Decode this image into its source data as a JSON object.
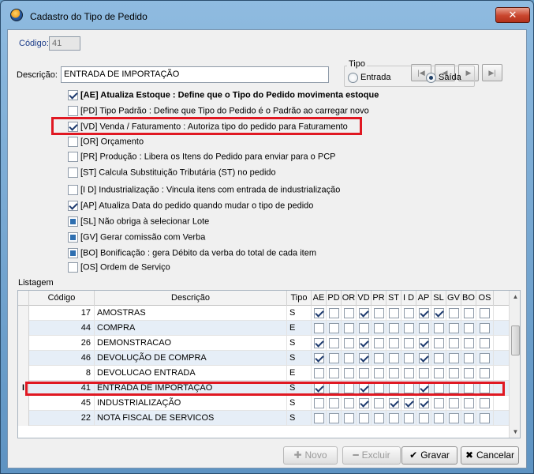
{
  "window": {
    "title": "Cadastro do Tipo de Pedido",
    "close_glyph": "✕"
  },
  "header": {
    "codigo_label": "Código:",
    "codigo_value": "41",
    "descricao_label": "Descrição:",
    "descricao_value": "ENTRADA DE IMPORTAÇÃO"
  },
  "nav_buttons": [
    {
      "name": "first-record-icon",
      "glyph": "|◀"
    },
    {
      "name": "prev-record-icon",
      "glyph": "◀"
    },
    {
      "name": "next-record-icon",
      "glyph": "▶"
    },
    {
      "name": "last-record-icon",
      "glyph": "▶|"
    }
  ],
  "tipo": {
    "label": "Tipo",
    "options": [
      {
        "label": "Entrada",
        "selected": false
      },
      {
        "label": "Saída",
        "selected": true
      }
    ]
  },
  "flags": [
    {
      "text": "[AE] Atualiza Estoque :  Define que o Tipo do Pedido movimenta estoque",
      "state": "checked",
      "bold": true
    },
    {
      "text": "[PD] Tipo Padrão :  Define que Tipo do Pedido é o Padrão ao carregar novo",
      "state": "unchecked",
      "bold": false
    },
    {
      "text": "[VD] Venda / Faturamento :  Autoriza tipo do pedido para Faturamento",
      "state": "checked",
      "bold": false
    },
    {
      "text": "[OR] Orçamento",
      "state": "unchecked",
      "bold": false
    },
    {
      "text": "[PR] Produção :  Libera os Itens do Pedido para enviar para o PCP",
      "state": "unchecked",
      "bold": false
    },
    {
      "text": "[ST] Calcula Substituição Tributária (ST) no pedido",
      "state": "unchecked",
      "bold": false
    },
    {
      "text": "[I D] Industrialização : Vincula itens com entrada de industrialização",
      "state": "unchecked",
      "bold": false
    },
    {
      "text": "[AP] Atualiza Data do pedido quando mudar o tipo de pedido",
      "state": "checked",
      "bold": false
    },
    {
      "text": "[SL] Não obriga à selecionar Lote",
      "state": "filled",
      "bold": false
    },
    {
      "text": "[GV] Gerar comissão com Verba",
      "state": "filled",
      "bold": false
    },
    {
      "text": "[BO] Bonificação : gera Débito da verba do total de cada item",
      "state": "filled",
      "bold": false
    },
    {
      "text": "[OS] Ordem de Serviço",
      "state": "unchecked",
      "bold": false
    }
  ],
  "listagem": {
    "label": "Listagem",
    "columns": [
      "Código",
      "Descrição",
      "Tipo",
      "AE",
      "PD",
      "OR",
      "VD",
      "PR",
      "ST",
      "I D",
      "AP",
      "SL",
      "GV",
      "BO",
      "OS"
    ],
    "rows": [
      {
        "codigo": "17",
        "descricao": "AMOSTRAS",
        "tipo": "S",
        "flags": [
          1,
          0,
          0,
          1,
          0,
          0,
          0,
          1,
          1,
          0,
          0,
          0
        ]
      },
      {
        "codigo": "44",
        "descricao": "COMPRA",
        "tipo": "E",
        "flags": [
          0,
          0,
          0,
          0,
          0,
          0,
          0,
          0,
          0,
          0,
          0,
          0
        ]
      },
      {
        "codigo": "26",
        "descricao": "DEMONSTRACAO",
        "tipo": "S",
        "flags": [
          1,
          0,
          0,
          1,
          0,
          0,
          0,
          1,
          0,
          0,
          0,
          0
        ]
      },
      {
        "codigo": "46",
        "descricao": "DEVOLUÇÃO DE COMPRA",
        "tipo": "S",
        "flags": [
          1,
          0,
          0,
          1,
          0,
          0,
          0,
          1,
          0,
          0,
          0,
          0
        ]
      },
      {
        "codigo": "8",
        "descricao": "DEVOLUCAO ENTRADA",
        "tipo": "E",
        "flags": [
          0,
          0,
          0,
          0,
          0,
          0,
          0,
          0,
          0,
          0,
          0,
          0
        ]
      },
      {
        "codigo": "41",
        "descricao": "ENTRADA DE IMPORTAÇÃO",
        "tipo": "S",
        "flags": [
          1,
          0,
          0,
          1,
          0,
          0,
          0,
          1,
          0,
          0,
          0,
          0
        ],
        "current": true
      },
      {
        "codigo": "45",
        "descricao": "INDUSTRIALIZAÇÃO",
        "tipo": "S",
        "flags": [
          0,
          0,
          0,
          1,
          0,
          1,
          1,
          1,
          0,
          0,
          0,
          0
        ]
      },
      {
        "codigo": "22",
        "descricao": "NOTA FISCAL DE SERVICOS",
        "tipo": "S",
        "flags": [
          0,
          0,
          0,
          0,
          0,
          0,
          0,
          0,
          0,
          0,
          0,
          0
        ]
      }
    ]
  },
  "buttons": {
    "novo": {
      "label": "Novo",
      "icon": "✚"
    },
    "excluir": {
      "label": "Excluir",
      "icon": "━"
    },
    "gravar": {
      "label": "Gravar",
      "icon": "✔"
    },
    "cancelar": {
      "label": "Cancelar",
      "icon": "✖"
    }
  },
  "colors": {
    "highlight": "#e01822",
    "checkbox_fill": "#2e6fb0",
    "alt_row": "#e6eef7"
  }
}
